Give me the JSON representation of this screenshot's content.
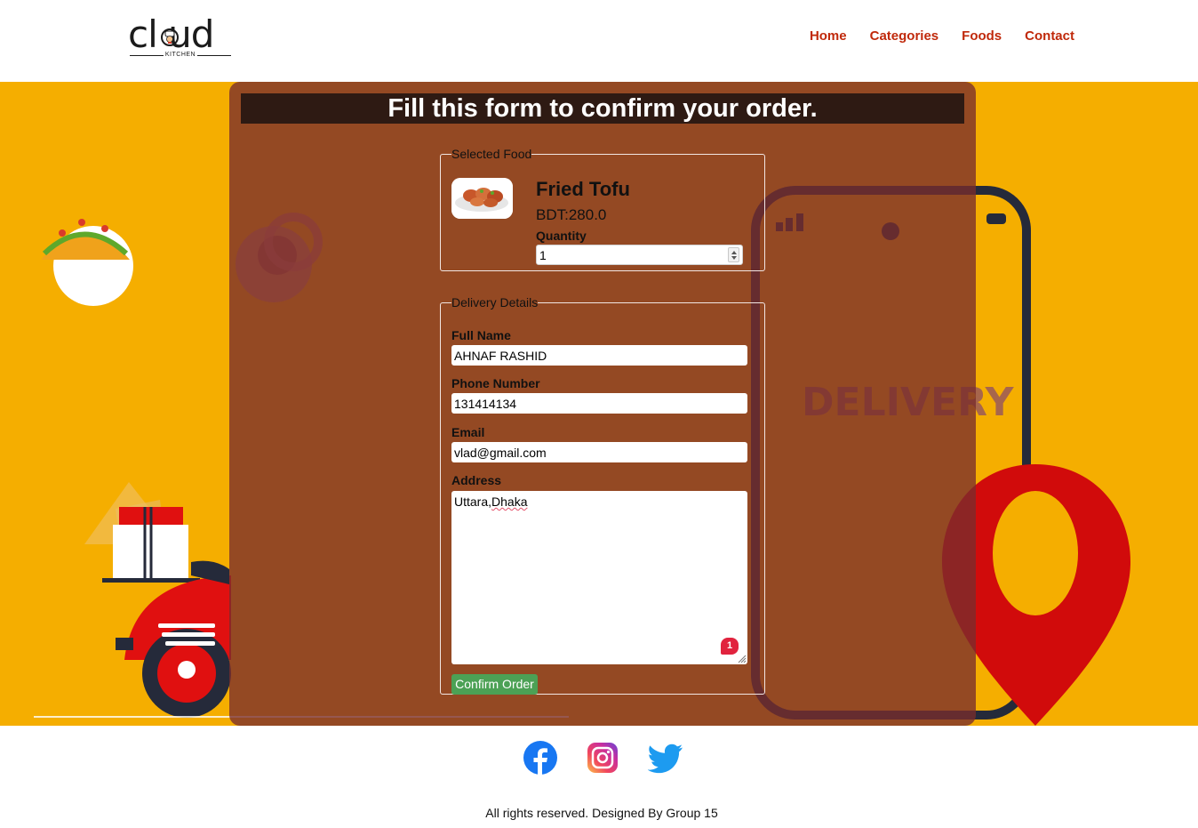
{
  "brand": {
    "logo_word": "cl ud",
    "logo_sub": "KITCHEN"
  },
  "nav": {
    "items": [
      {
        "label": "Home"
      },
      {
        "label": "Categories"
      },
      {
        "label": "Foods"
      },
      {
        "label": "Contact"
      }
    ]
  },
  "hero": {
    "background_text": "DELIVERY"
  },
  "form": {
    "title": "Fill this form to confirm your order.",
    "selected_food": {
      "legend": "Selected Food",
      "name": "Fried Tofu",
      "price": "BDT:280.0",
      "quantity_label": "Quantity",
      "quantity_value": "1"
    },
    "delivery": {
      "legend": "Delivery Details",
      "full_name_label": "Full Name",
      "full_name_value": "AHNAF RASHID",
      "phone_label": "Phone Number",
      "phone_value": "131414134",
      "email_label": "Email",
      "email_value": "vlad@gmail.com",
      "address_label": "Address",
      "address_value_part1": "Uttara,",
      "address_value_part2": "Dhaka",
      "spellcheck_badge": "1"
    },
    "confirm_button": "Confirm Order"
  },
  "footer": {
    "social": [
      "facebook-icon",
      "instagram-icon",
      "twitter-icon"
    ],
    "copyright": "All rights reserved. Designed By Group 15"
  },
  "colors": {
    "nav_link": "#c0290b",
    "hero_bg": "#f5ae00",
    "panel_overlay": "#792d2d",
    "title_bar": "#2e1a13",
    "confirm_button": "#4ca155"
  }
}
